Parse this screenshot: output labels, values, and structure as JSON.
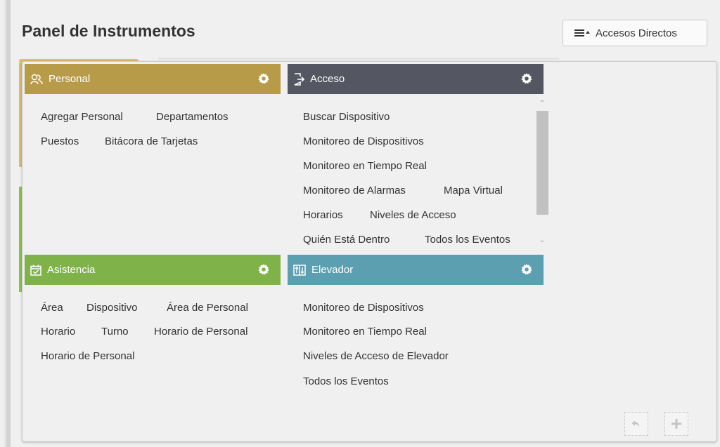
{
  "page": {
    "title": "Panel de Instrumentos"
  },
  "toolbar": {
    "shortcuts_label": "Accesos Directos",
    "shortcuts_icon": "list-menu-icon"
  },
  "personal": {
    "title": "Personal",
    "color": "#b89b48",
    "links": [
      "Agregar Personal",
      "Departamentos",
      "Puestos",
      "Bitácora de Tarjetas"
    ]
  },
  "acceso": {
    "title": "Acceso",
    "color": "#545662",
    "links": [
      "Buscar Dispositivo",
      "Monitoreo de Dispositivos",
      "Monitoreo en Tiempo Real",
      "Monitoreo de Alarmas",
      "Mapa Virtual",
      "Horarios",
      "Niveles de Acceso",
      "Quién Está Dentro",
      "Todos los Eventos"
    ]
  },
  "asistencia": {
    "title": "Asistencia",
    "color": "#7fb34a",
    "links": [
      "Área",
      "Dispositivo",
      "Área de Personal",
      "Horario",
      "Turno",
      "Horario de Personal",
      "Horario de Personal"
    ]
  },
  "elevador": {
    "title": "Elevador",
    "color": "#5b9fb1",
    "links": [
      "Monitoreo de Dispositivos",
      "Monitoreo en Tiempo Real",
      "Niveles de Acceso de Elevador",
      "Todos los Eventos"
    ]
  }
}
